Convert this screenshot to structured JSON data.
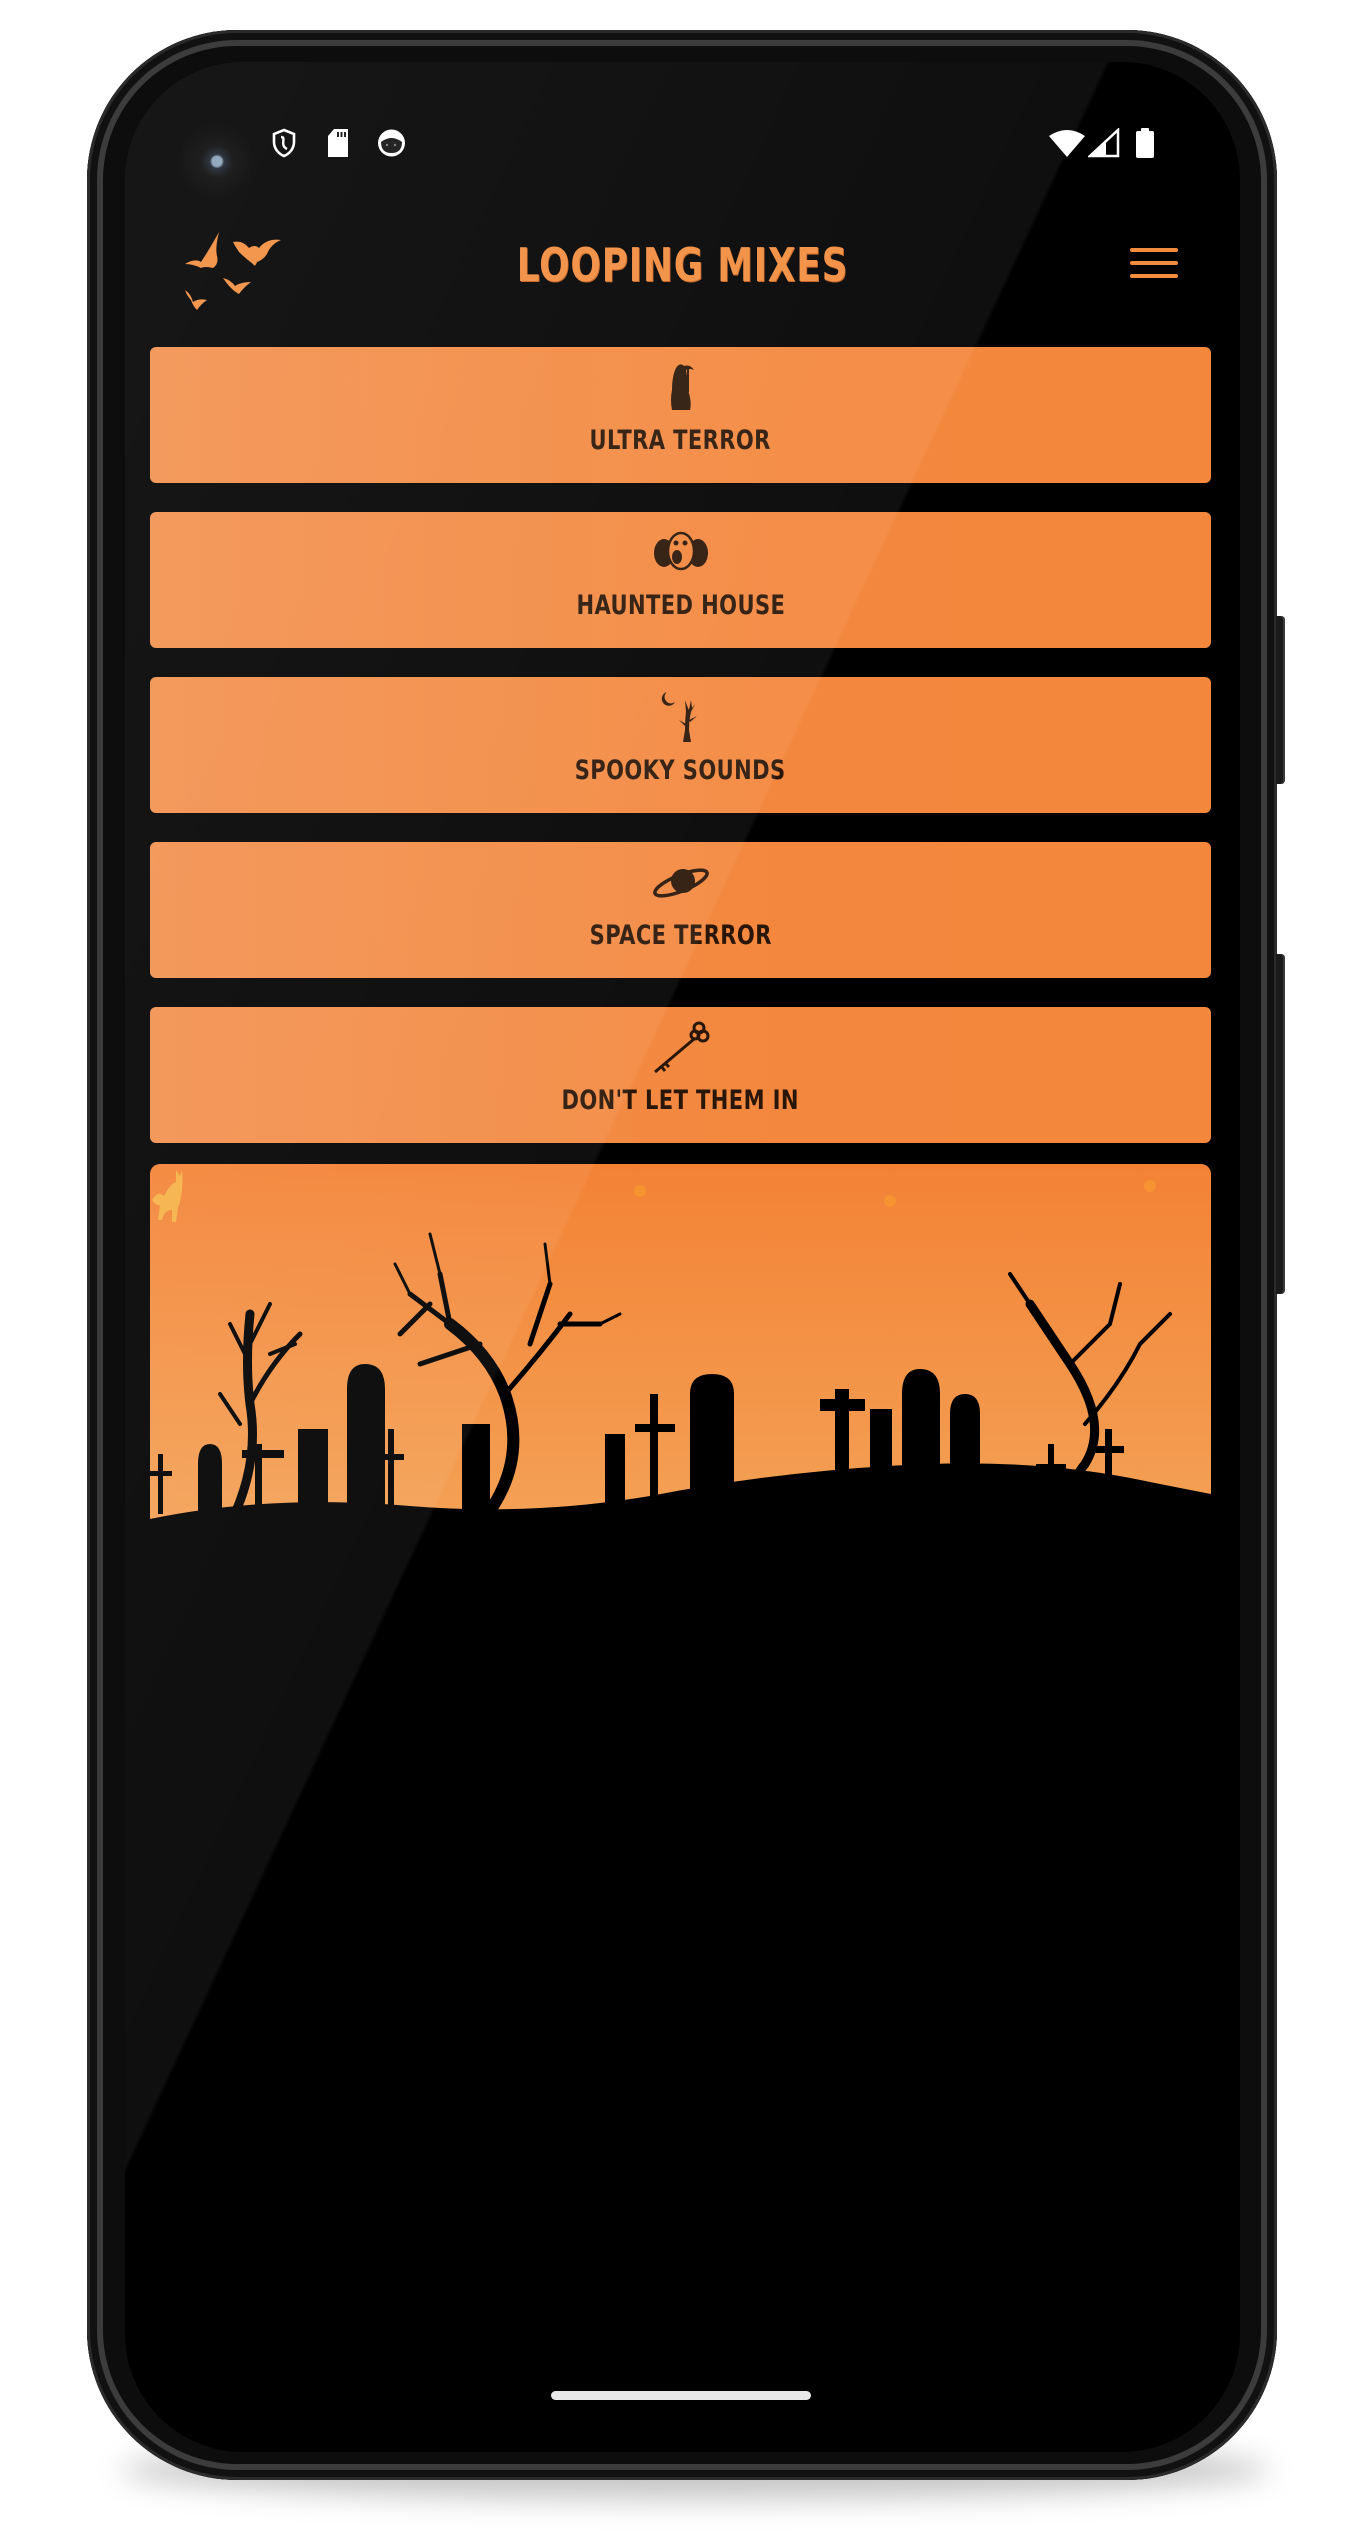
{
  "app": {
    "title": "LOOPING MIXES",
    "accent_color": "#F28C3E",
    "button_color": "#F3873D",
    "background_color": "#000000"
  },
  "status_bar": {
    "left_icons": [
      "shield-icon",
      "sd-card-icon",
      "app-notification-icon"
    ],
    "right_icons": [
      "wifi-icon",
      "cellular-signal-icon",
      "battery-icon"
    ]
  },
  "header": {
    "logo_icon": "bats-icon",
    "menu_icon": "hamburger-menu-icon"
  },
  "mixes": [
    {
      "label": "Ultra Terror",
      "icon": "grim-reaper-icon"
    },
    {
      "label": "Haunted House",
      "icon": "scary-clown-icon"
    },
    {
      "label": "Spooky Sounds",
      "icon": "dead-tree-moon-icon"
    },
    {
      "label": "Space Terror",
      "icon": "planet-icon"
    },
    {
      "label": "Don't Let Them In",
      "icon": "skeleton-key-icon"
    }
  ],
  "scene": {
    "name": "graveyard-illustration",
    "elements": [
      "black-cat-icon",
      "dead-trees",
      "tombstones",
      "crosses"
    ]
  }
}
